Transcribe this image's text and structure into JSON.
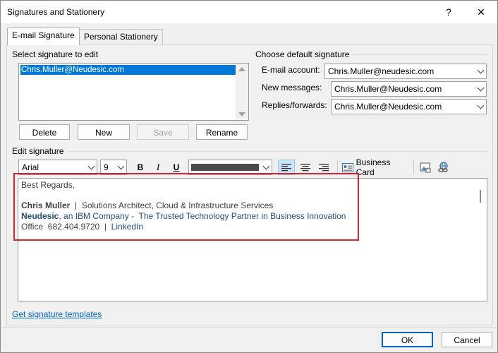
{
  "window": {
    "title": "Signatures and Stationery",
    "help_glyph": "?",
    "close_glyph": "✕"
  },
  "tabs": [
    {
      "label": "E-mail Signature",
      "active": true
    },
    {
      "label": "Personal Stationery",
      "active": false
    }
  ],
  "select_signature": {
    "label": "Select signature to edit",
    "items": [
      "Chris.Muller@Neudesic.com"
    ],
    "selected_index": 0
  },
  "signature_buttons": {
    "delete": "Delete",
    "new": "New",
    "save": "Save",
    "rename": "Rename"
  },
  "default_signature": {
    "label": "Choose default signature",
    "email_account_label": "E-mail account:",
    "email_account_value": "Chris.Muller@neudesic.com",
    "new_messages_label": "New messages:",
    "new_messages_value": "Chris.Muller@Neudesic.com",
    "replies_label": "Replies/forwards:",
    "replies_value": "Chris.Muller@Neudesic.com"
  },
  "edit_signature": {
    "label": "Edit signature",
    "font": "Arial",
    "size": "9",
    "bold_glyph": "B",
    "italic_glyph": "I",
    "underline_glyph": "U",
    "business_card_label": "Business Card"
  },
  "signature_body": {
    "greeting": "Best Regards,",
    "name": "Chris Muller",
    "title_sep": "  |  ",
    "title": "Solutions Architect, Cloud & Infrastructure Services",
    "company": "Neudesic",
    "company_rest": ", an IBM Company -  The Trusted Technology Partner in Business Innovation",
    "office_label": "Office  682.404.9720  |  ",
    "linkedin": "LinkedIn"
  },
  "colors": {
    "accent": "#0078d7",
    "brand_text": "#1f4e79",
    "highlight_box": "#d9232f",
    "link": "#0066cc"
  },
  "templates_link": "Get signature templates",
  "footer": {
    "ok": "OK",
    "cancel": "Cancel"
  }
}
